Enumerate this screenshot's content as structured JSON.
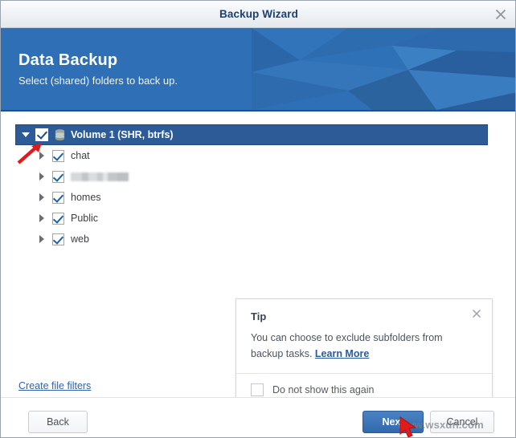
{
  "window": {
    "title": "Backup Wizard",
    "close_icon": "close-icon"
  },
  "banner": {
    "heading": "Data Backup",
    "subheading": "Select (shared) folders to back up."
  },
  "tree": {
    "root": {
      "label": "Volume 1 (SHR, btrfs)",
      "checked": true,
      "expanded": true,
      "icon": "volume-icon"
    },
    "children": [
      {
        "label": "chat",
        "checked": true,
        "redacted": false
      },
      {
        "label": "",
        "checked": true,
        "redacted": true
      },
      {
        "label": "homes",
        "checked": true,
        "redacted": false
      },
      {
        "label": "Public",
        "checked": true,
        "redacted": false
      },
      {
        "label": "web",
        "checked": true,
        "redacted": false
      }
    ]
  },
  "tip": {
    "title": "Tip",
    "text": "You can choose to exclude subfolders from backup tasks.",
    "link_label": "Learn More",
    "dont_show_label": "Do not show this again",
    "dont_show_checked": false,
    "close_icon": "close-icon"
  },
  "links": {
    "create_file_filters": "Create file filters"
  },
  "footer": {
    "back_label": "Back",
    "next_label": "Next",
    "cancel_label": "Cancel"
  },
  "watermark": {
    "text": "www.wsxdn.com"
  },
  "colors": {
    "banner_blue": "#2f6fb5",
    "selected_row": "#2d5b97",
    "primary_button": "#3269ac",
    "link_blue": "#2f62a8",
    "cursor_red": "#e01b1b"
  }
}
